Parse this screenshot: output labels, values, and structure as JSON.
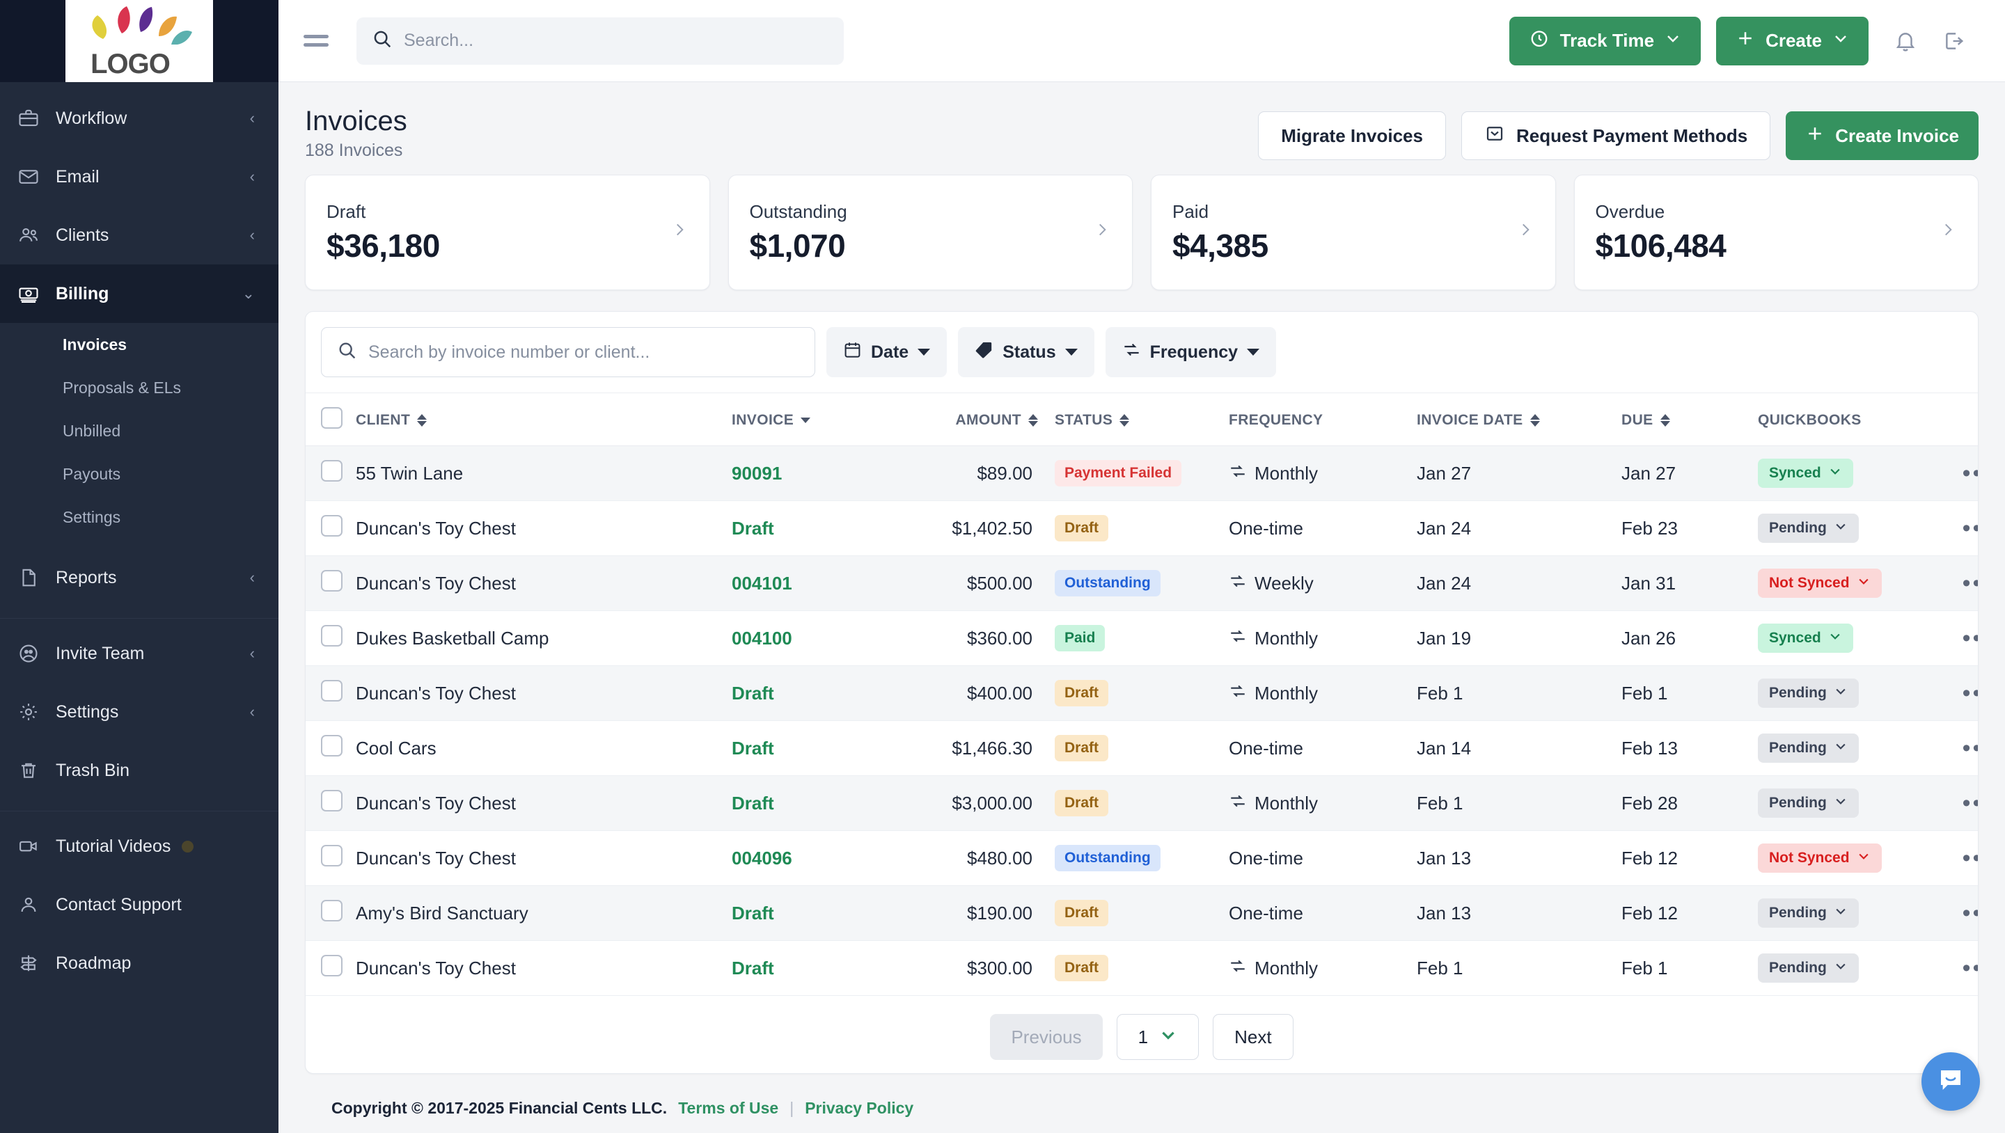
{
  "brand": {
    "logo_text": "LOGO",
    "accent_green": "#35925f",
    "sidebar_bg": "#222b3c"
  },
  "topbar": {
    "search_placeholder": "Search...",
    "track_time_label": "Track Time",
    "create_label": "Create"
  },
  "sidebar": {
    "items": [
      {
        "label": "Workflow",
        "icon": "briefcase-icon",
        "chevron": "‹"
      },
      {
        "label": "Email",
        "icon": "envelope-icon",
        "chevron": "‹"
      },
      {
        "label": "Clients",
        "icon": "people-icon",
        "chevron": "‹"
      },
      {
        "label": "Billing",
        "icon": "money-icon",
        "chevron": "⌄",
        "active": true
      },
      {
        "label": "Reports",
        "icon": "document-icon",
        "chevron": "‹"
      }
    ],
    "billing_subitems": [
      {
        "label": "Invoices",
        "active": true
      },
      {
        "label": "Proposals & ELs"
      },
      {
        "label": "Unbilled"
      },
      {
        "label": "Payouts"
      },
      {
        "label": "Settings"
      }
    ],
    "lower_items": [
      {
        "label": "Invite Team",
        "icon": "invite-team-icon",
        "chevron": "‹"
      },
      {
        "label": "Settings",
        "icon": "gear-icon",
        "chevron": "‹"
      },
      {
        "label": "Trash Bin",
        "icon": "trash-icon",
        "chevron": ""
      }
    ],
    "help_items": [
      {
        "label": "Tutorial Videos",
        "icon": "video-icon",
        "badge": true
      },
      {
        "label": "Contact Support",
        "icon": "person-icon"
      },
      {
        "label": "Roadmap",
        "icon": "signpost-icon"
      }
    ]
  },
  "page": {
    "title": "Invoices",
    "subtitle": "188 Invoices",
    "actions": {
      "migrate": "Migrate Invoices",
      "request_payment_methods": "Request Payment Methods",
      "create_invoice": "Create Invoice"
    }
  },
  "stats": [
    {
      "label": "Draft",
      "value": "$36,180"
    },
    {
      "label": "Outstanding",
      "value": "$1,070"
    },
    {
      "label": "Paid",
      "value": "$4,385"
    },
    {
      "label": "Overdue",
      "value": "$106,484"
    }
  ],
  "filters": {
    "search_placeholder": "Search by invoice number or client...",
    "date": "Date",
    "status": "Status",
    "frequency": "Frequency"
  },
  "table": {
    "columns": [
      {
        "key": "client",
        "label": "CLIENT",
        "sort": "both"
      },
      {
        "key": "invoice",
        "label": "INVOICE",
        "sort": "down"
      },
      {
        "key": "amount",
        "label": "AMOUNT",
        "sort": "both"
      },
      {
        "key": "status",
        "label": "STATUS",
        "sort": "both"
      },
      {
        "key": "frequency",
        "label": "FREQUENCY",
        "sort": "none"
      },
      {
        "key": "invoice_date",
        "label": "INVOICE DATE",
        "sort": "both"
      },
      {
        "key": "due",
        "label": "DUE",
        "sort": "both"
      },
      {
        "key": "quickbooks",
        "label": "QUICKBOOKS",
        "sort": "none"
      }
    ],
    "rows": [
      {
        "client": "55 Twin Lane",
        "invoice": "90091",
        "amount": "$89.00",
        "status": "Payment Failed",
        "status_type": "failed",
        "frequency": "Monthly",
        "recurring": true,
        "invoice_date": "Jan 27",
        "due": "Jan 27",
        "quickbooks": "Synced",
        "qb_type": "synced"
      },
      {
        "client": "Duncan's Toy Chest",
        "invoice": "Draft",
        "amount": "$1,402.50",
        "status": "Draft",
        "status_type": "draft",
        "frequency": "One-time",
        "recurring": false,
        "invoice_date": "Jan 24",
        "due": "Feb 23",
        "quickbooks": "Pending",
        "qb_type": "pending"
      },
      {
        "client": "Duncan's Toy Chest",
        "invoice": "004101",
        "amount": "$500.00",
        "status": "Outstanding",
        "status_type": "outstanding",
        "frequency": "Weekly",
        "recurring": true,
        "invoice_date": "Jan 24",
        "due": "Jan 31",
        "quickbooks": "Not Synced",
        "qb_type": "notsynced"
      },
      {
        "client": "Dukes Basketball Camp",
        "invoice": "004100",
        "amount": "$360.00",
        "status": "Paid",
        "status_type": "paid",
        "frequency": "Monthly",
        "recurring": true,
        "invoice_date": "Jan 19",
        "due": "Jan 26",
        "quickbooks": "Synced",
        "qb_type": "synced"
      },
      {
        "client": "Duncan's Toy Chest",
        "invoice": "Draft",
        "amount": "$400.00",
        "status": "Draft",
        "status_type": "draft",
        "frequency": "Monthly",
        "recurring": true,
        "invoice_date": "Feb 1",
        "due": "Feb 1",
        "quickbooks": "Pending",
        "qb_type": "pending"
      },
      {
        "client": "Cool Cars",
        "invoice": "Draft",
        "amount": "$1,466.30",
        "status": "Draft",
        "status_type": "draft",
        "frequency": "One-time",
        "recurring": false,
        "invoice_date": "Jan 14",
        "due": "Feb 13",
        "quickbooks": "Pending",
        "qb_type": "pending"
      },
      {
        "client": "Duncan's Toy Chest",
        "invoice": "Draft",
        "amount": "$3,000.00",
        "status": "Draft",
        "status_type": "draft",
        "frequency": "Monthly",
        "recurring": true,
        "invoice_date": "Feb 1",
        "due": "Feb 28",
        "quickbooks": "Pending",
        "qb_type": "pending"
      },
      {
        "client": "Duncan's Toy Chest",
        "invoice": "004096",
        "amount": "$480.00",
        "status": "Outstanding",
        "status_type": "outstanding",
        "frequency": "One-time",
        "recurring": false,
        "invoice_date": "Jan 13",
        "due": "Feb 12",
        "quickbooks": "Not Synced",
        "qb_type": "notsynced"
      },
      {
        "client": "Amy's Bird Sanctuary",
        "invoice": "Draft",
        "amount": "$190.00",
        "status": "Draft",
        "status_type": "draft",
        "frequency": "One-time",
        "recurring": false,
        "invoice_date": "Jan 13",
        "due": "Feb 12",
        "quickbooks": "Pending",
        "qb_type": "pending"
      },
      {
        "client": "Duncan's Toy Chest",
        "invoice": "Draft",
        "amount": "$300.00",
        "status": "Draft",
        "status_type": "draft",
        "frequency": "Monthly",
        "recurring": true,
        "invoice_date": "Feb 1",
        "due": "Feb 1",
        "quickbooks": "Pending",
        "qb_type": "pending"
      }
    ]
  },
  "pagination": {
    "previous": "Previous",
    "page": "1",
    "next": "Next"
  },
  "footer": {
    "copyright": "Copyright © 2017-2025 Financial Cents LLC.",
    "terms": "Terms of Use",
    "separator": "|",
    "privacy": "Privacy Policy"
  },
  "status_colors": {
    "failed": {
      "bg": "#fde8e8",
      "fg": "#d63434"
    },
    "draft": {
      "bg": "#fbe8c8",
      "fg": "#946213"
    },
    "outstanding": {
      "bg": "#d9e6fb",
      "fg": "#2060d6"
    },
    "paid": {
      "bg": "#c9f4de",
      "fg": "#17804f"
    }
  },
  "qb_colors": {
    "synced": {
      "bg": "#c9f4de",
      "fg": "#17804f"
    },
    "pending": {
      "bg": "#e4e6ea",
      "fg": "#3a4356"
    },
    "notsynced": {
      "bg": "#fbd8d8",
      "fg": "#d81f1f"
    }
  }
}
